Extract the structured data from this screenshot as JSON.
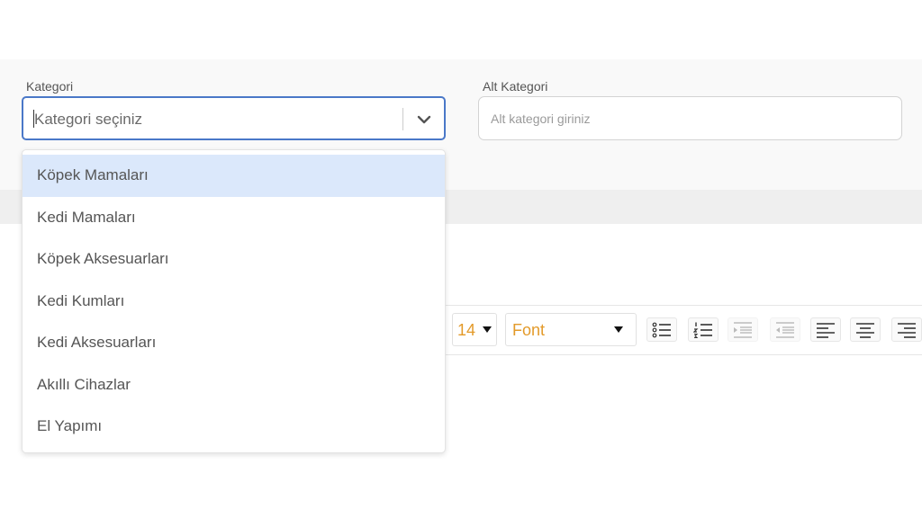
{
  "form": {
    "category_label": "Kategori",
    "category_placeholder": "Kategori seçiniz",
    "subcategory_label": "Alt Kategori",
    "subcategory_placeholder": "Alt kategori giriniz"
  },
  "dropdown": {
    "options": [
      "Köpek Mamaları",
      "Kedi Mamaları",
      "Köpek Aksesuarları",
      "Kedi Kumları",
      "Kedi Aksesuarları",
      "Akıllı Cihazlar",
      "El Yapımı"
    ],
    "highlighted_index": 0
  },
  "editor_toolbar": {
    "font_size": "14",
    "font_family": "Font",
    "buttons": [
      "unordered-list-icon",
      "ordered-list-icon",
      "indent-icon",
      "outdent-icon",
      "align-left-icon",
      "align-center-icon",
      "align-right-icon"
    ]
  },
  "colors": {
    "focus_border": "#4a78c8",
    "option_highlight": "#dbe8fb",
    "toolbar_value": "#e39a2a"
  }
}
